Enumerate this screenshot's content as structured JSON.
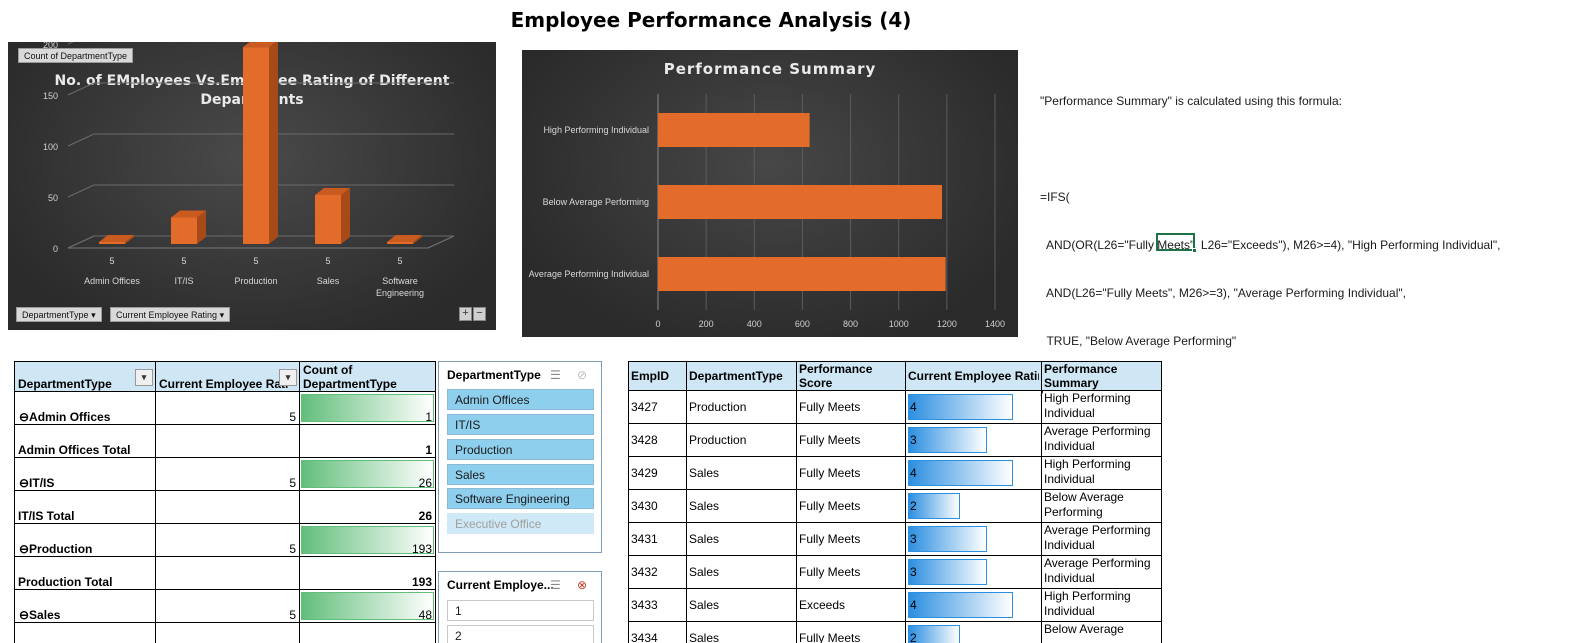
{
  "title": "Employee Performance Analysis (4)",
  "chart1": {
    "field_button": "Count of DepartmentType",
    "title": "No. of EMployees Vs.Employee Rating of Different Departments",
    "filter_buttons": [
      "DepartmentType",
      "Current Employee Rating"
    ],
    "y_ticks": [
      "200",
      "150",
      "100",
      "50",
      "0"
    ],
    "plus": "+",
    "minus": "−"
  },
  "chart2": {
    "title": "Performance Summary",
    "x_ticks": [
      "0",
      "200",
      "400",
      "600",
      "800",
      "1000",
      "1200",
      "1400"
    ]
  },
  "chart_data": [
    {
      "type": "bar",
      "title": "No. of EMployees Vs.Employee Rating of Different Departments",
      "categories": [
        "Admin Offices",
        "IT/IS",
        "Production",
        "Sales",
        "Software Engineering"
      ],
      "rating_labels": [
        "5",
        "5",
        "5",
        "5",
        "5"
      ],
      "values": [
        1,
        26,
        193,
        48,
        1
      ],
      "ylim": [
        0,
        200
      ],
      "grid": true,
      "colors": [
        "#e46c2a"
      ]
    },
    {
      "type": "bar",
      "orientation": "horizontal",
      "title": "Performance Summary",
      "categories": [
        "High Performing Individual",
        "Below Average Performing",
        "Average Performing Individual"
      ],
      "values": [
        630,
        1180,
        1195
      ],
      "xlim": [
        0,
        1400
      ],
      "grid": true,
      "colors": [
        "#e46c2a"
      ]
    }
  ],
  "formula": {
    "lines": [
      "\"Performance Summary\" is calculated using this formula:",
      "",
      "=IFS(",
      "  AND(OR(L26=\"Fully Meets\", L26=\"Exceeds\"), M26>=4), \"High Performing Individual\",",
      "  AND(L26=\"Fully Meets\", M26>=3), \"Average Performing Individual\",",
      "  TRUE, \"Below Average Performing\"",
      ")"
    ]
  },
  "pivot": {
    "headers": [
      "DepartmentType",
      "Current Employee Rati",
      "Count of DepartmentType"
    ],
    "rows": [
      {
        "label": "⊖Admin Offices",
        "rating": "5",
        "count": "1",
        "bar": 1.0,
        "total": false
      },
      {
        "label": "Admin Offices Total",
        "rating": "",
        "count": "1",
        "bar": 0,
        "total": true
      },
      {
        "label": "⊖IT/IS",
        "rating": "5",
        "count": "26",
        "bar": 1.0,
        "total": false
      },
      {
        "label": "IT/IS Total",
        "rating": "",
        "count": "26",
        "bar": 0,
        "total": true
      },
      {
        "label": "⊖Production",
        "rating": "5",
        "count": "193",
        "bar": 1.0,
        "total": false
      },
      {
        "label": "Production    Total",
        "rating": "",
        "count": "193",
        "bar": 0,
        "total": true
      },
      {
        "label": "⊖Sales",
        "rating": "5",
        "count": "48",
        "bar": 1.0,
        "total": false
      }
    ]
  },
  "slicer1": {
    "header": "DepartmentType",
    "items": [
      "Admin Offices",
      "IT/IS",
      "Production",
      "Sales",
      "Software Engineering",
      "Executive Office"
    ]
  },
  "slicer2": {
    "header": "Current Employe...",
    "items": [
      "1",
      "2"
    ]
  },
  "emp_table": {
    "headers": [
      "EmpID",
      "DepartmentType",
      "Performance Score",
      "Current Employee Rating",
      "Performance Summary"
    ],
    "rows": [
      {
        "id": "3427",
        "dept": "Production",
        "score": "Fully Meets",
        "rating": "4",
        "rating_level": 4,
        "summary": "High Performing Individual"
      },
      {
        "id": "3428",
        "dept": "Production",
        "score": "Fully Meets",
        "rating": "3",
        "rating_level": 3,
        "summary": "Average Performing Individual"
      },
      {
        "id": "3429",
        "dept": "Sales",
        "score": "Fully Meets",
        "rating": "4",
        "rating_level": 4,
        "summary": "High Performing Individual"
      },
      {
        "id": "3430",
        "dept": "Sales",
        "score": "Fully Meets",
        "rating": "2",
        "rating_level": 2,
        "summary": "Below Average Performing"
      },
      {
        "id": "3431",
        "dept": "Sales",
        "score": "Fully Meets",
        "rating": "3",
        "rating_level": 3,
        "summary": "Average Performing Individual"
      },
      {
        "id": "3432",
        "dept": "Sales",
        "score": "Fully Meets",
        "rating": "3",
        "rating_level": 3,
        "summary": "Average Performing Individual"
      },
      {
        "id": "3433",
        "dept": "Sales",
        "score": "Exceeds",
        "rating": "4",
        "rating_level": 4,
        "summary": "High Performing Individual"
      },
      {
        "id": "3434",
        "dept": "Sales",
        "score": "Fully Meets",
        "rating": "2",
        "rating_level": 2,
        "summary": "Below Average"
      }
    ]
  }
}
